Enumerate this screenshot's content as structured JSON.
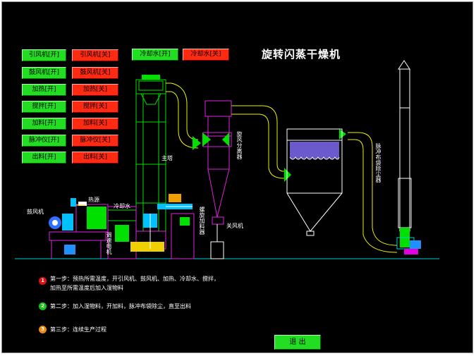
{
  "title": "旋转闪蒸干燥机",
  "buttons": {
    "induced_fan_on": "引风机[开]",
    "induced_fan_off": "引风机[关]",
    "blower_on": "鼓风机[开]",
    "blower_off": "鼓风机[关]",
    "heating_on": "加热[开]",
    "heating_off": "加热[关]",
    "stirring_on": "搅拌[开]",
    "stirring_off": "搅拌[关]",
    "feeding_on": "加料[开]",
    "feeding_off": "加料[关]",
    "pulse_on": "脉冲仪[开]",
    "pulse_off": "脉冲仪[关]",
    "discharge_on": "出料[开]",
    "discharge_off": "出料[关]",
    "cooling_on": "冷却水[开]",
    "cooling_off": "冷却水[关]"
  },
  "labels": {
    "blower": "鼓风机",
    "heat_source": "热源",
    "cooling_water": "冷却水",
    "main_tower": "主塔",
    "cyclone": "旋风分离器",
    "screw_feeder": "螺旋加料器",
    "closed_fan": "关风机",
    "bag_filter": "脉冲布袋除尘器",
    "stir_motor": "调速电机"
  },
  "steps": [
    {
      "num": "1",
      "text": "第一步：预热所需温度，开引风机、鼓风机、加热、冷却水、搅拌，",
      "text2": "加热至所需温度后加入湿物料",
      "color": "#e21010"
    },
    {
      "num": "2",
      "text": "第二步：加入湿物料，开加料，脉冲布袋除尘，直至出料",
      "text2": "",
      "color": "#18c418"
    },
    {
      "num": "3",
      "text": "第三步：连续生产过程",
      "text2": "",
      "color": "#f08a10"
    }
  ],
  "exit_label": "退 出"
}
